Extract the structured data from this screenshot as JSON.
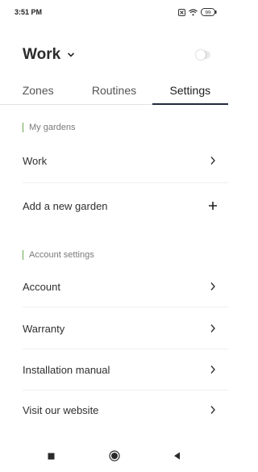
{
  "status": {
    "time": "3:51 PM",
    "battery": "99"
  },
  "header": {
    "garden_name": "Work"
  },
  "tabs": [
    {
      "label": "Zones",
      "active": false
    },
    {
      "label": "Routines",
      "active": false
    },
    {
      "label": "Settings",
      "active": true
    }
  ],
  "my_gardens": {
    "title": "My gardens",
    "items": [
      {
        "label": "Work",
        "icon": "chevron-right-icon"
      },
      {
        "label": "Add a new garden",
        "icon": "plus-icon"
      }
    ]
  },
  "account_settings": {
    "title": "Account settings",
    "items": [
      {
        "label": "Account",
        "icon": "chevron-right-icon"
      },
      {
        "label": "Warranty",
        "icon": "chevron-right-icon"
      },
      {
        "label": "Installation manual",
        "icon": "chevron-right-icon"
      },
      {
        "label": "Visit our website",
        "icon": "chevron-right-icon"
      }
    ]
  },
  "colors": {
    "accent": "#6aa84f",
    "tab_indicator": "#1f2a3a"
  }
}
